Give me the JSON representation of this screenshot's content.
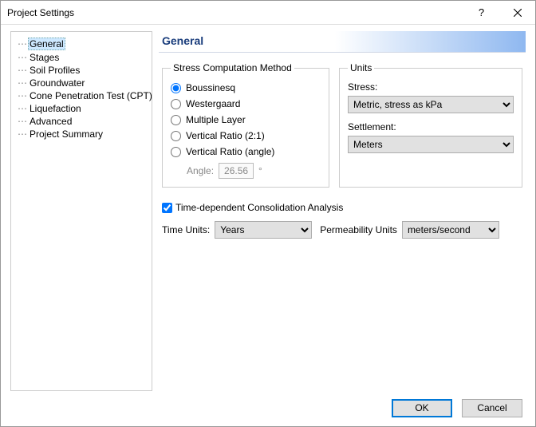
{
  "window": {
    "title": "Project Settings"
  },
  "sidebar": {
    "items": [
      {
        "label": "General",
        "selected": true
      },
      {
        "label": "Stages"
      },
      {
        "label": "Soil Profiles"
      },
      {
        "label": "Groundwater"
      },
      {
        "label": "Cone Penetration Test (CPT)"
      },
      {
        "label": "Liquefaction"
      },
      {
        "label": "Advanced"
      },
      {
        "label": "Project Summary"
      }
    ]
  },
  "main": {
    "heading": "General",
    "stressGroup": {
      "legend": "Stress Computation Method",
      "options": {
        "boussinesq": "Boussinesq",
        "westergaard": "Westergaard",
        "multiple": "Multiple Layer",
        "vratio21": "Vertical Ratio (2:1)",
        "vratioangle": "Vertical Ratio (angle)"
      },
      "angleLabel": "Angle:",
      "angleValue": "26.56",
      "angleUnit": "°"
    },
    "unitsGroup": {
      "legend": "Units",
      "stressLabel": "Stress:",
      "stressValue": "Metric, stress as kPa",
      "settlementLabel": "Settlement:",
      "settlementValue": "Meters"
    },
    "consolidation": {
      "checkboxLabel": "Time-dependent Consolidation Analysis",
      "timeUnitsLabel": "Time Units:",
      "timeUnitsValue": "Years",
      "permLabel": "Permeability Units",
      "permValue": "meters/second"
    }
  },
  "buttons": {
    "ok": "OK",
    "cancel": "Cancel"
  }
}
